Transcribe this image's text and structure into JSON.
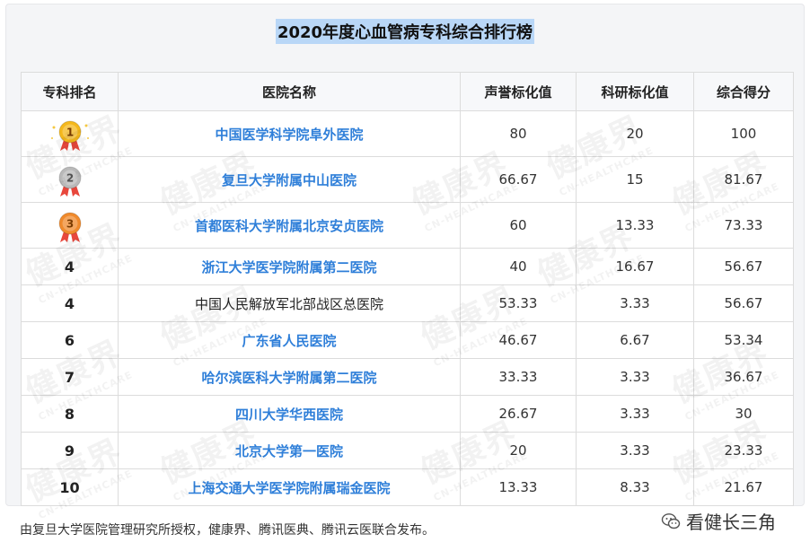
{
  "title": "2020年度心血管病专科综合排行榜",
  "headers": {
    "rank": "专科排名",
    "hospital": "医院名称",
    "reputation": "声誉标化值",
    "research": "科研标化值",
    "total": "综合得分"
  },
  "rows": [
    {
      "rank": "1",
      "medal": "gold",
      "hospital": "中国医学科学院阜外医院",
      "link": true,
      "reputation": "80",
      "research": "20",
      "total": "100"
    },
    {
      "rank": "2",
      "medal": "silver",
      "hospital": "复旦大学附属中山医院",
      "link": true,
      "reputation": "66.67",
      "research": "15",
      "total": "81.67"
    },
    {
      "rank": "3",
      "medal": "bronze",
      "hospital": "首都医科大学附属北京安贞医院",
      "link": true,
      "reputation": "60",
      "research": "13.33",
      "total": "73.33"
    },
    {
      "rank": "4",
      "hospital": "浙江大学医学院附属第二医院",
      "link": true,
      "reputation": "40",
      "research": "16.67",
      "total": "56.67"
    },
    {
      "rank": "4",
      "hospital": "中国人民解放军北部战区总医院",
      "link": false,
      "reputation": "53.33",
      "research": "3.33",
      "total": "56.67"
    },
    {
      "rank": "6",
      "hospital": "广东省人民医院",
      "link": true,
      "reputation": "46.67",
      "research": "6.67",
      "total": "53.34"
    },
    {
      "rank": "7",
      "hospital": "哈尔滨医科大学附属第二医院",
      "link": true,
      "reputation": "33.33",
      "research": "3.33",
      "total": "36.67"
    },
    {
      "rank": "8",
      "hospital": "四川大学华西医院",
      "link": true,
      "reputation": "26.67",
      "research": "3.33",
      "total": "30"
    },
    {
      "rank": "9",
      "hospital": "北京大学第一医院",
      "link": true,
      "reputation": "20",
      "research": "3.33",
      "total": "23.33"
    },
    {
      "rank": "10",
      "hospital": "上海交通大学医学院附属瑞金医院",
      "link": true,
      "reputation": "13.33",
      "research": "8.33",
      "total": "21.67"
    }
  ],
  "watermark": {
    "cn": "健康界",
    "en": "CN-HEALTHCARE"
  },
  "footer": "由复旦大学医院管理研究所授权，健康界、腾讯医典、腾讯云医联合发布。",
  "brand": "看健长三角",
  "colors": {
    "link": "#2f7fd9",
    "title_highlight": "#b9d7f7",
    "gold": "#f5b81c",
    "silver": "#b9b9b9",
    "bronze": "#f08a2c",
    "ribbon": "#e8473c"
  }
}
